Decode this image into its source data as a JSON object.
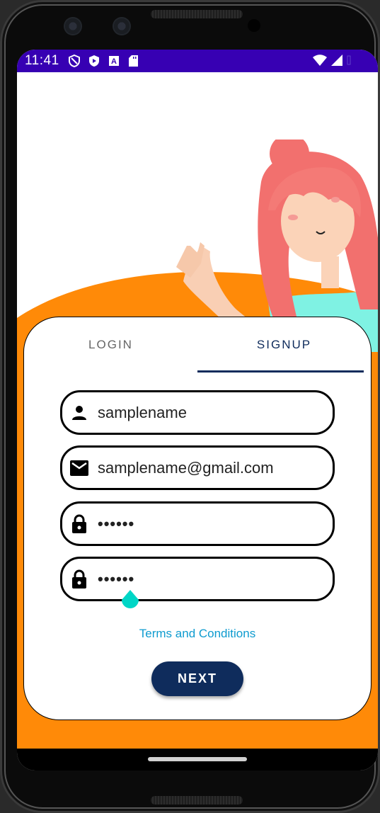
{
  "status_bar": {
    "time": "11:41",
    "left_icons": [
      "shield-outline-icon",
      "play-protect-icon",
      "font-a-icon",
      "sd-card-icon"
    ],
    "right_icons": [
      "wifi-icon",
      "cell-signal-icon",
      "battery-icon"
    ]
  },
  "hero": {
    "illustration": "waving-girl-illustration",
    "colors": {
      "background": "#ffffff",
      "accent": "#ff8a08"
    }
  },
  "tabs": [
    {
      "label": "LOGIN",
      "active": false
    },
    {
      "label": "SIGNUP",
      "active": true
    }
  ],
  "form": {
    "fields": [
      {
        "icon": "person-icon",
        "value": "samplename",
        "type": "text"
      },
      {
        "icon": "email-icon",
        "value": "samplename@gmail.com",
        "type": "email"
      },
      {
        "icon": "lock-icon",
        "value": "••••••",
        "type": "password"
      },
      {
        "icon": "lock-icon",
        "value": "••••••",
        "type": "password"
      }
    ],
    "terms_link": "Terms and Conditions",
    "next_button": "NEXT"
  },
  "colors": {
    "status_bar": "#3700b3",
    "primary": "#0f2c5c",
    "link": "#0e9bcf",
    "orange": "#ff8a08",
    "cursor_handle": "#00d6c6"
  }
}
